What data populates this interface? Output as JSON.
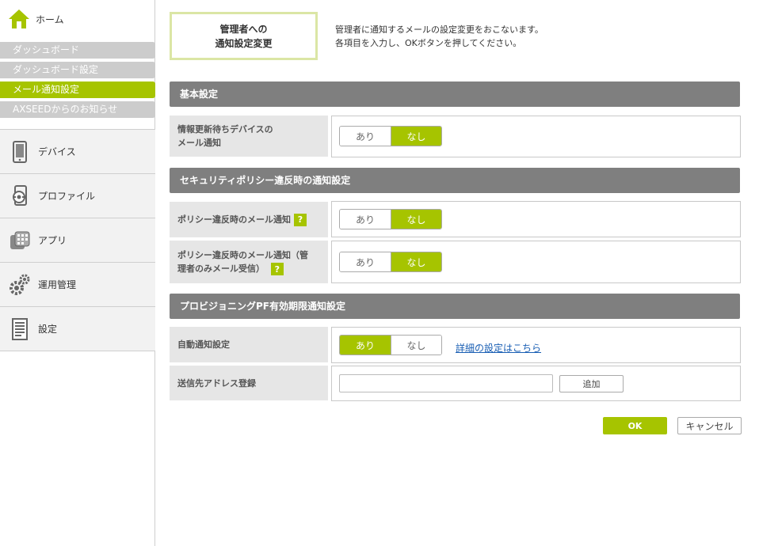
{
  "sidebar": {
    "home_label": "ホーム",
    "submenu": [
      {
        "label": "ダッシュボード",
        "active": false
      },
      {
        "label": "ダッシュボード設定",
        "active": false
      },
      {
        "label": "メール通知設定",
        "active": true
      },
      {
        "label": "AXSEEDからのお知らせ",
        "active": false
      }
    ],
    "nav": [
      {
        "label": "デバイス",
        "icon": "device-icon"
      },
      {
        "label": "プロファイル",
        "icon": "profile-icon"
      },
      {
        "label": "アプリ",
        "icon": "apps-icon"
      },
      {
        "label": "運用管理",
        "icon": "gear-icon"
      },
      {
        "label": "設定",
        "icon": "settings-document-icon"
      }
    ]
  },
  "page": {
    "title_line1": "管理者への",
    "title_line2": "通知設定変更",
    "intro_line1": "管理者に通知するメールの設定変更をおこないます。",
    "intro_line2": "各項目を入力し、OKボタンを押してください。"
  },
  "sections": {
    "basic": {
      "header": "基本設定",
      "row1_label_line1": "情報更新待ちデバイスの",
      "row1_label_line2": "メール通知"
    },
    "security": {
      "header": "セキュリティポリシー違反時の通知設定",
      "row1_label": "ポリシー違反時のメール通知",
      "row2_label_line1": "ポリシー違反時のメール通知（管",
      "row2_label_line2": "理者のみメール受信）"
    },
    "provisioning": {
      "header": "プロビジョニングPF有効期限通知設定",
      "row1_label": "自動通知設定",
      "detail_link": "詳細の設定はこちら",
      "row2_label": "送信先アドレス登録",
      "add_button": "追加",
      "address_value": ""
    }
  },
  "toggle": {
    "yes": "あり",
    "no": "なし"
  },
  "help_mark": "?",
  "actions": {
    "ok": "OK",
    "cancel": "キャンセル"
  },
  "colors": {
    "accent": "#a6c400",
    "header_bg": "#7f7f7f",
    "label_bg": "#e6e6e6"
  }
}
